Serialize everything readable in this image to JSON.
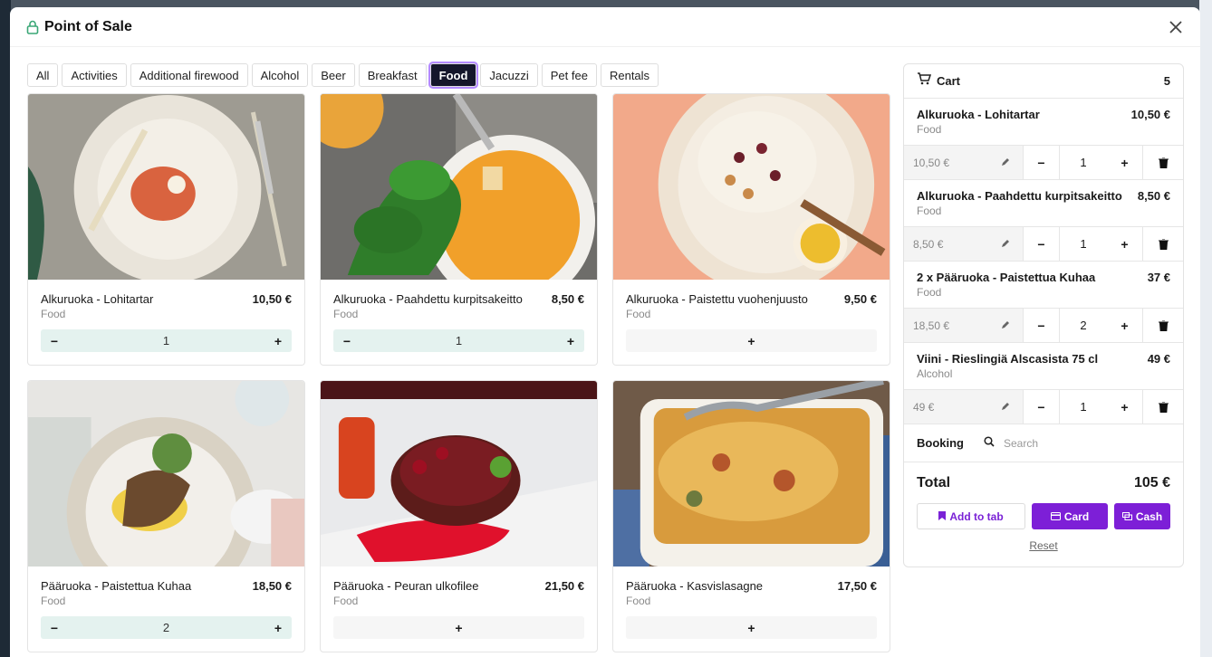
{
  "modal": {
    "title": "Point of Sale"
  },
  "tabs": [
    "All",
    "Activities",
    "Additional firewood",
    "Alcohol",
    "Beer",
    "Breakfast",
    "Food",
    "Jacuzzi",
    "Pet fee",
    "Rentals"
  ],
  "active_tab": "Food",
  "products": [
    {
      "name": "Alkuruoka - Lohitartar",
      "price": "10,50 €",
      "category": "Food",
      "qty": "1",
      "in_cart": true
    },
    {
      "name": "Alkuruoka - Paahdettu kurpitsakeitto",
      "price": "8,50 €",
      "category": "Food",
      "qty": "1",
      "in_cart": true
    },
    {
      "name": "Alkuruoka - Paistettu vuohenjuusto",
      "price": "9,50 €",
      "category": "Food",
      "qty": "",
      "in_cart": false
    },
    {
      "name": "Pääruoka - Paistettua Kuhaa",
      "price": "18,50 €",
      "category": "Food",
      "qty": "2",
      "in_cart": true
    },
    {
      "name": "Pääruoka - Peuran ulkofilee",
      "price": "21,50 €",
      "category": "Food",
      "qty": "",
      "in_cart": false
    },
    {
      "name": "Pääruoka - Kasvislasagne",
      "price": "17,50 €",
      "category": "Food",
      "qty": "",
      "in_cart": false
    }
  ],
  "stepper": {
    "minus": "−",
    "plus": "+"
  },
  "cart": {
    "title": "Cart",
    "count": "5",
    "items": [
      {
        "name": "Alkuruoka - Lohitartar",
        "category": "Food",
        "price": "10,50 €",
        "unit_price": "10,50 €",
        "qty": "1"
      },
      {
        "name": "Alkuruoka - Paahdettu kurpitsakeitto",
        "category": "Food",
        "price": "8,50 €",
        "unit_price": "8,50 €",
        "qty": "1"
      },
      {
        "name": "2 x Pääruoka - Paistettua Kuhaa",
        "category": "Food",
        "price": "37 €",
        "unit_price": "18,50 €",
        "qty": "2"
      },
      {
        "name": "Viini - Rieslingiä Alscasista 75 cl",
        "category": "Alcohol",
        "price": "49 €",
        "unit_price": "49 €",
        "qty": "1"
      }
    ],
    "booking_label": "Booking",
    "booking_placeholder": "Search",
    "total_label": "Total",
    "total_value": "105 €",
    "add_to_tab": "Add to tab",
    "card": "Card",
    "cash": "Cash",
    "reset": "Reset"
  },
  "colors": {
    "accent": "#7d1fd7",
    "active_tab_bg": "#15162b",
    "stepper_bg": "#e4f2ef"
  }
}
